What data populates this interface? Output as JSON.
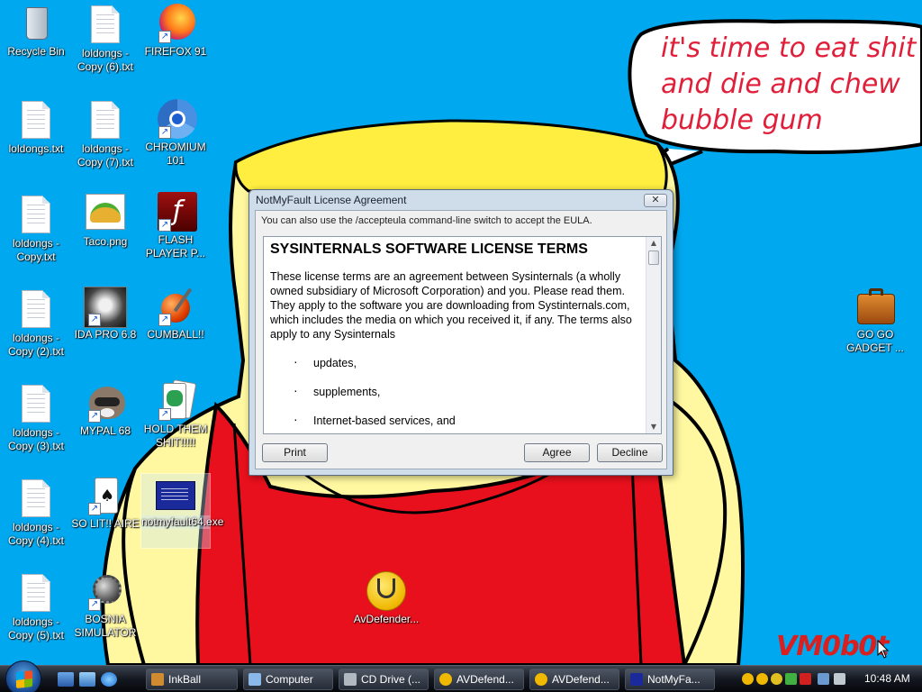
{
  "wallpaper": {
    "speech_text": "it's time to eat shit\nand die and chew\nbubble gum",
    "signature": "VM0b0t"
  },
  "desktop_icons": [
    {
      "label": "Recycle Bin",
      "icon": "recycle-bin-icon"
    },
    {
      "label": "loldongs - Copy (6).txt",
      "icon": "text-file-icon"
    },
    {
      "label": "FIREFOX 91",
      "icon": "firefox-icon"
    },
    {
      "label": "loldongs.txt",
      "icon": "text-file-icon"
    },
    {
      "label": "loldongs - Copy (7).txt",
      "icon": "text-file-icon"
    },
    {
      "label": "CHROMIUM 101",
      "icon": "chromium-icon"
    },
    {
      "label": "loldongs - Copy.txt",
      "icon": "text-file-icon"
    },
    {
      "label": "Taco.png",
      "icon": "taco-image-icon"
    },
    {
      "label": "FLASH PLAYER P...",
      "icon": "flash-player-icon"
    },
    {
      "label": "loldongs - Copy (2).txt",
      "icon": "text-file-icon"
    },
    {
      "label": "IDA PRO 6.8",
      "icon": "ida-pro-icon"
    },
    {
      "label": "CUMBALL!!",
      "icon": "ball-icon"
    },
    {
      "label": "loldongs - Copy (3).txt",
      "icon": "text-file-icon"
    },
    {
      "label": "MYPAL 68",
      "icon": "raccoon-icon"
    },
    {
      "label": "HOLD THEM SHIT!!!!!",
      "icon": "cards-icon"
    },
    {
      "label": "loldongs - Copy (4).txt",
      "icon": "text-file-icon"
    },
    {
      "label": "SO LIT!! AIRE",
      "icon": "solitaire-icon"
    },
    {
      "label": "notmyfault64.exe",
      "icon": "bsod-exe-icon"
    },
    {
      "label": "loldongs - Copy (5).txt",
      "icon": "text-file-icon"
    },
    {
      "label": "BOSNIA SIMULATOR",
      "icon": "mine-icon"
    },
    {
      "label": "AvDefender...",
      "icon": "stethoscope-icon"
    },
    {
      "label": "GO GO GADGET ...",
      "icon": "briefcase-icon"
    }
  ],
  "dialog": {
    "title": "NotMyFault License Agreement",
    "close": "✕",
    "hint": "You can also use the /accepteula command-line switch to accept the EULA.",
    "heading": "SYSINTERNALS SOFTWARE LICENSE TERMS",
    "paragraph": "These license terms are an agreement between Sysinternals (a wholly owned subsidiary of Microsoft Corporation) and you.  Please read them. They apply to the software you are downloading from Systinternals.com, which includes the media on which you received it, if any.  The terms also apply to any Sysinternals",
    "bullets": [
      "updates,",
      "supplements,",
      "Internet-based services, and"
    ],
    "buttons": {
      "print": "Print",
      "agree": "Agree",
      "decline": "Decline"
    }
  },
  "taskbar": {
    "tasks": [
      {
        "label": "InkBall",
        "icon": "inkball-icon"
      },
      {
        "label": "Computer",
        "icon": "computer-icon"
      },
      {
        "label": "CD Drive (...",
        "icon": "cd-drive-icon"
      },
      {
        "label": "AVDefend...",
        "icon": "stethoscope-icon"
      },
      {
        "label": "AVDefend...",
        "icon": "stethoscope-icon"
      },
      {
        "label": "NotMyFa...",
        "icon": "bsod-exe-icon"
      }
    ],
    "clock": "10:48 AM"
  },
  "colors": {
    "desktop": "#00a8f0",
    "speech_text": "#e0203a",
    "shirt": "#e8101c",
    "hair": "#ffee40"
  }
}
